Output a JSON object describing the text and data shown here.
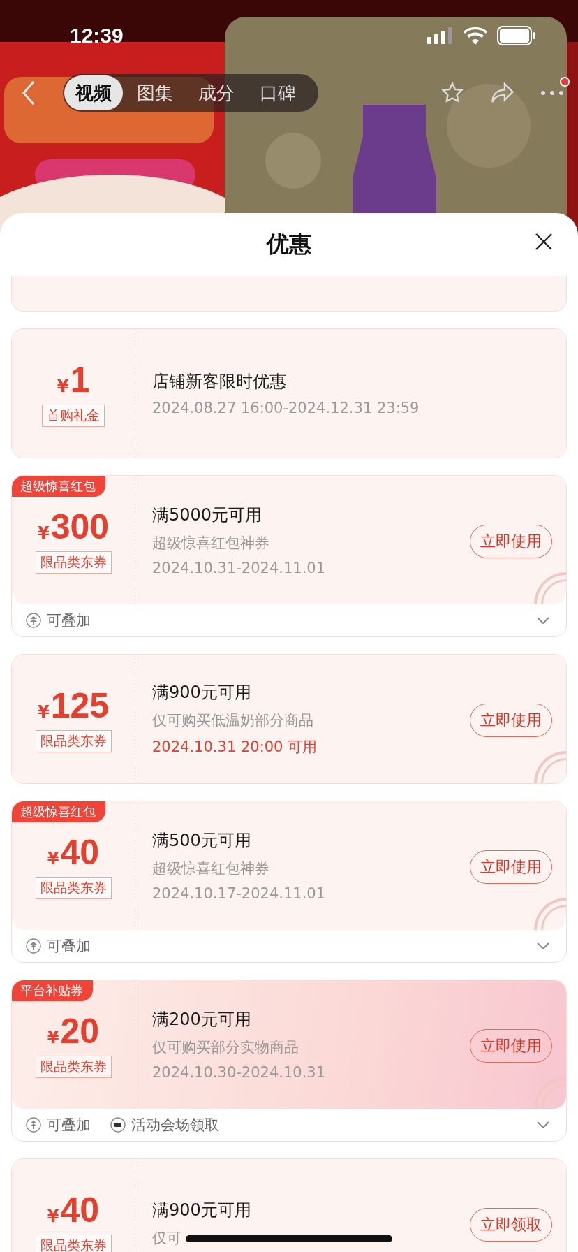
{
  "status_bar": {
    "time": "12:39"
  },
  "nav": {
    "tabs": [
      {
        "label": "视频",
        "selected": true
      },
      {
        "label": "图集",
        "selected": false
      },
      {
        "label": "成分",
        "selected": false
      },
      {
        "label": "口碑",
        "selected": false
      }
    ],
    "notification_dot": true
  },
  "sheet": {
    "title": "优惠"
  },
  "coupons": [
    {
      "partial": true
    },
    {
      "amount": "1",
      "currency": "¥",
      "label": "首购礼金",
      "title": "店铺新客限时优惠",
      "date": "2024.08.27 16:00-2024.12.31 23:59",
      "date_highlight": false,
      "promo": false,
      "claimed": false
    },
    {
      "tag": "超级惊喜红包",
      "amount": "300",
      "currency": "¥",
      "label": "限品类东券",
      "title": "满5000元可用",
      "subtitle": "超级惊喜红包神券",
      "date": "2024.10.31-2024.11.01",
      "date_highlight": false,
      "button": "立即使用",
      "claimed": true,
      "promo": false,
      "features": [
        {
          "kind": "stackable",
          "label": "可叠加"
        }
      ]
    },
    {
      "amount": "125",
      "currency": "¥",
      "label": "限品类东券",
      "title": "满900元可用",
      "subtitle": "仅可购买低温奶部分商品",
      "date": "2024.10.31 20:00 可用",
      "date_highlight": true,
      "button": "立即使用",
      "claimed": true,
      "promo": false
    },
    {
      "tag": "超级惊喜红包",
      "amount": "40",
      "currency": "¥",
      "label": "限品类东券",
      "title": "满500元可用",
      "subtitle": "超级惊喜红包神券",
      "date": "2024.10.17-2024.11.01",
      "date_highlight": false,
      "button": "立即使用",
      "claimed": true,
      "promo": false,
      "features": [
        {
          "kind": "stackable",
          "label": "可叠加"
        }
      ]
    },
    {
      "tag": "平台补贴券",
      "amount": "20",
      "currency": "¥",
      "label": "限品类东券",
      "title": "满200元可用",
      "subtitle": "仅可购买部分实物商品",
      "date": "2024.10.30-2024.10.31",
      "date_highlight": false,
      "button": "立即使用",
      "claimed": true,
      "promo": true,
      "features": [
        {
          "kind": "stackable",
          "label": "可叠加"
        },
        {
          "kind": "venue",
          "label": "活动会场领取"
        }
      ]
    },
    {
      "amount": "40",
      "currency": "¥",
      "label": "限品类东券",
      "title": "满900元可用",
      "subtitle": "仅可",
      "button": "立即领取",
      "claimed": false,
      "promo": false
    }
  ]
}
